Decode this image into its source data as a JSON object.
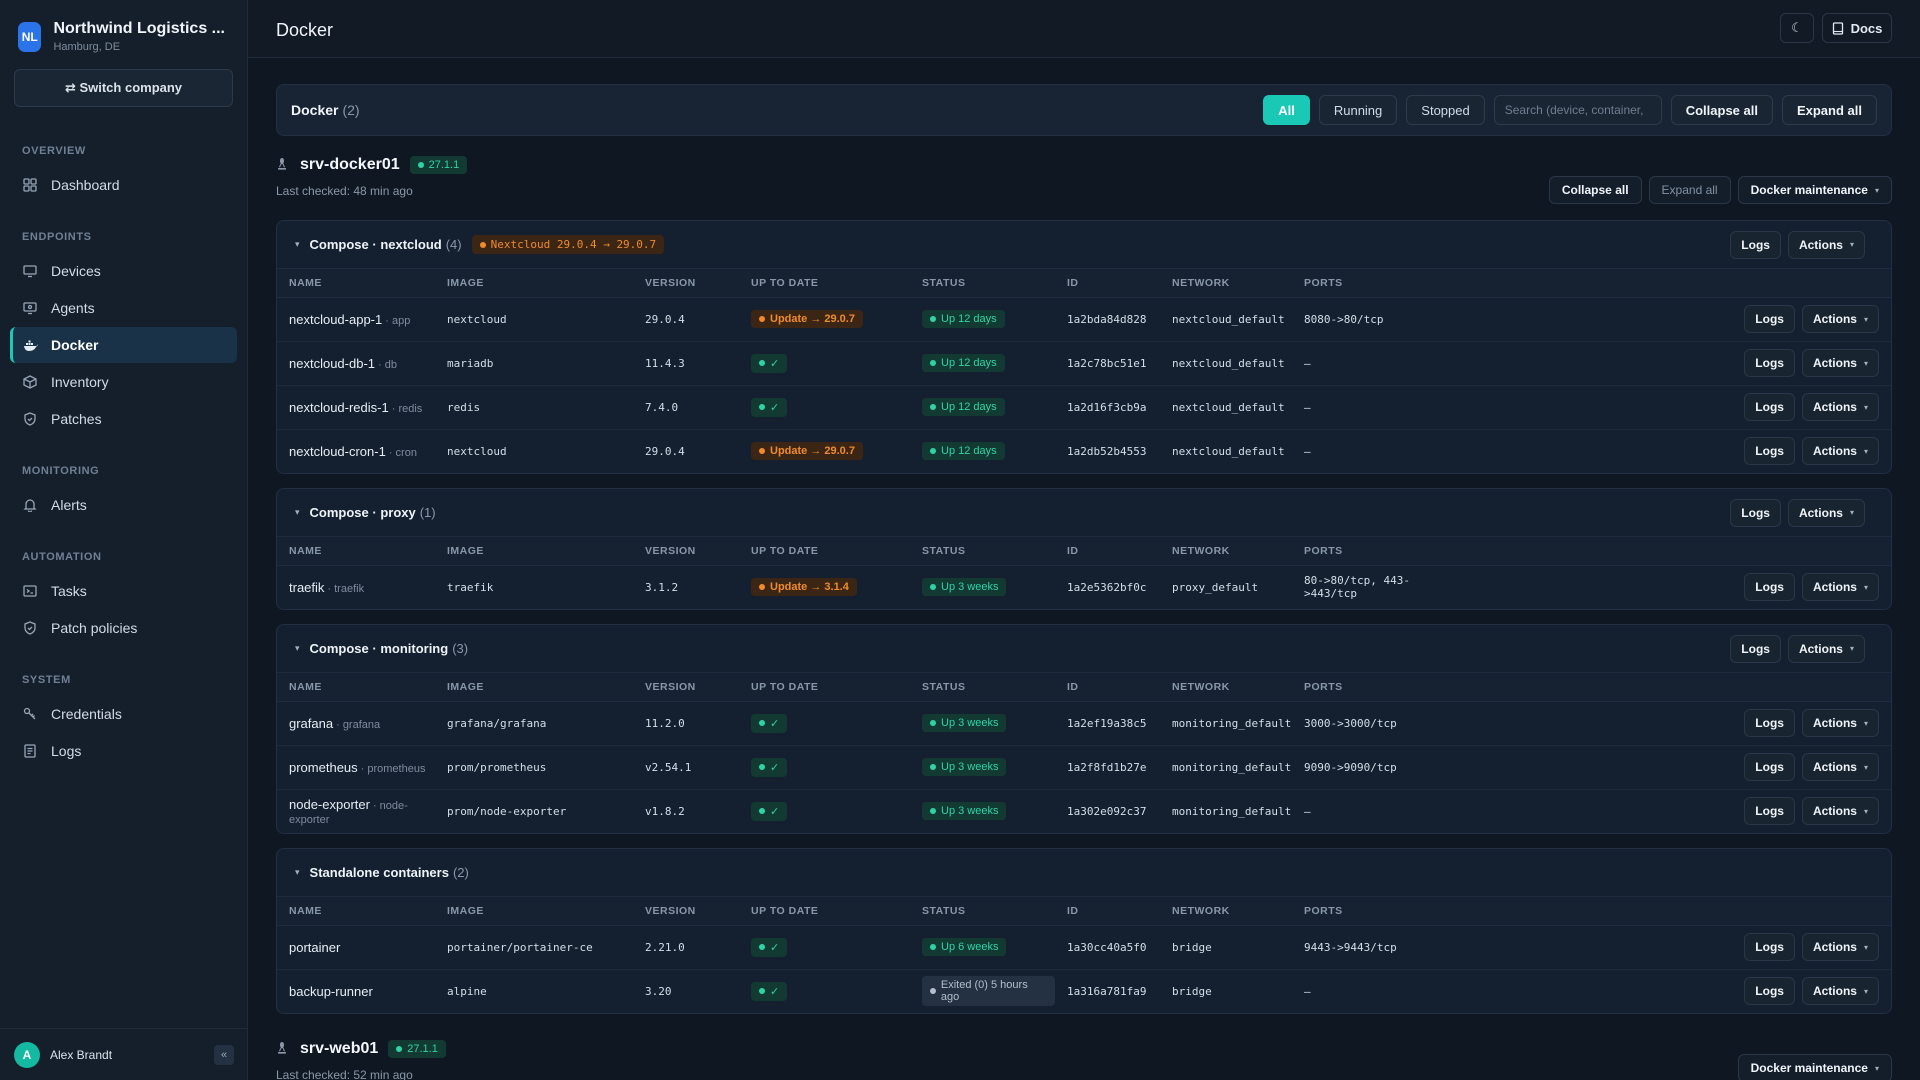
{
  "sidebar": {
    "company_initials": "NL",
    "company_name": "Northwind Logistics ...",
    "company_location": "Hamburg, DE",
    "switch_label": "⇄ Switch company",
    "sections": [
      {
        "title": "OVERVIEW",
        "items": [
          {
            "label": "Dashboard",
            "icon": "dashboard-icon"
          }
        ]
      },
      {
        "title": "ENDPOINTS",
        "items": [
          {
            "label": "Devices",
            "icon": "monitor-icon"
          },
          {
            "label": "Agents",
            "icon": "agent-icon"
          },
          {
            "label": "Docker",
            "icon": "docker-icon",
            "active": true
          },
          {
            "label": "Inventory",
            "icon": "box-icon"
          },
          {
            "label": "Patches",
            "icon": "shield-icon"
          }
        ]
      },
      {
        "title": "MONITORING",
        "items": [
          {
            "label": "Alerts",
            "icon": "bell-icon"
          }
        ]
      },
      {
        "title": "AUTOMATION",
        "items": [
          {
            "label": "Tasks",
            "icon": "terminal-icon"
          },
          {
            "label": "Patch policies",
            "icon": "shield-check-icon"
          }
        ]
      },
      {
        "title": "SYSTEM",
        "items": [
          {
            "label": "Credentials",
            "icon": "key-icon"
          },
          {
            "label": "Logs",
            "icon": "file-icon"
          }
        ]
      }
    ],
    "user_initial": "A",
    "user_name": "Alex Brandt",
    "collapse_label": "«"
  },
  "header": {
    "title": "Docker",
    "theme_icon": "moon-icon",
    "docs_label": "Docs"
  },
  "filterbar": {
    "title": "Docker",
    "count": "(2)",
    "filters": [
      "All",
      "Running",
      "Stopped"
    ],
    "search_placeholder": "Search (device, container,",
    "collapse_all": "Collapse all",
    "expand_all": "Expand all"
  },
  "columns": [
    "NAME",
    "IMAGE",
    "VERSION",
    "UP TO DATE",
    "STATUS",
    "ID",
    "NETWORK",
    "PORTS"
  ],
  "labels": {
    "logs": "Logs",
    "actions": "Actions",
    "collapse_all": "Collapse all",
    "expand_all": "Expand all",
    "docker_maintenance": "Docker maintenance"
  },
  "hosts": [
    {
      "name": "srv-docker01",
      "version": "27.1.1",
      "last_checked": "Last checked: 48 min ago",
      "groups": [
        {
          "title": "Compose · nextcloud",
          "count": "(4)",
          "badge": "Nextcloud 29.0.4 → 29.0.7",
          "rows": [
            {
              "name": "nextcloud-app-1",
              "svc": "· app",
              "image": "nextcloud",
              "version": "29.0.4",
              "uptodate": "Update → 29.0.7",
              "update": true,
              "status": "Up 12 days",
              "exited": false,
              "id": "1a2bda84d828",
              "network": "nextcloud_default",
              "ports": "8080->80/tcp"
            },
            {
              "name": "nextcloud-db-1",
              "svc": "· db",
              "image": "mariadb",
              "version": "11.4.3",
              "uptodate": "✓",
              "update": false,
              "status": "Up 12 days",
              "exited": false,
              "id": "1a2c78bc51e1",
              "network": "nextcloud_default",
              "ports": "–"
            },
            {
              "name": "nextcloud-redis-1",
              "svc": "· redis",
              "image": "redis",
              "version": "7.4.0",
              "uptodate": "✓",
              "update": false,
              "status": "Up 12 days",
              "exited": false,
              "id": "1a2d16f3cb9a",
              "network": "nextcloud_default",
              "ports": "–"
            },
            {
              "name": "nextcloud-cron-1",
              "svc": "· cron",
              "image": "nextcloud",
              "version": "29.0.4",
              "uptodate": "Update → 29.0.7",
              "update": true,
              "status": "Up 12 days",
              "exited": false,
              "id": "1a2db52b4553",
              "network": "nextcloud_default",
              "ports": "–"
            }
          ]
        },
        {
          "title": "Compose · proxy",
          "count": "(1)",
          "badge": "",
          "rows": [
            {
              "name": "traefik",
              "svc": "· traefik",
              "image": "traefik",
              "version": "3.1.2",
              "uptodate": "Update → 3.1.4",
              "update": true,
              "status": "Up 3 weeks",
              "exited": false,
              "id": "1a2e5362bf0c",
              "network": "proxy_default",
              "ports": "80->80/tcp, 443->443/tcp"
            }
          ]
        },
        {
          "title": "Compose · monitoring",
          "count": "(3)",
          "badge": "",
          "rows": [
            {
              "name": "grafana",
              "svc": "· grafana",
              "image": "grafana/grafana",
              "version": "11.2.0",
              "uptodate": "✓",
              "update": false,
              "status": "Up 3 weeks",
              "exited": false,
              "id": "1a2ef19a38c5",
              "network": "monitoring_default",
              "ports": "3000->3000/tcp"
            },
            {
              "name": "prometheus",
              "svc": "· prometheus",
              "image": "prom/prometheus",
              "version": "v2.54.1",
              "uptodate": "✓",
              "update": false,
              "status": "Up 3 weeks",
              "exited": false,
              "id": "1a2f8fd1b27e",
              "network": "monitoring_default",
              "ports": "9090->9090/tcp"
            },
            {
              "name": "node-exporter",
              "svc": "· node-exporter",
              "image": "prom/node-exporter",
              "version": "v1.8.2",
              "uptodate": "✓",
              "update": false,
              "status": "Up 3 weeks",
              "exited": false,
              "id": "1a302e092c37",
              "network": "monitoring_default",
              "ports": "–"
            }
          ]
        },
        {
          "title": "Standalone containers",
          "count": "(2)",
          "badge": "",
          "rows": [
            {
              "name": "portainer",
              "svc": "",
              "image": "portainer/portainer-ce",
              "version": "2.21.0",
              "uptodate": "✓",
              "update": false,
              "status": "Up 6 weeks",
              "exited": false,
              "id": "1a30cc40a5f0",
              "network": "bridge",
              "ports": "9443->9443/tcp"
            },
            {
              "name": "backup-runner",
              "svc": "",
              "image": "alpine",
              "version": "3.20",
              "uptodate": "✓",
              "update": false,
              "status": "Exited (0) 5 hours ago",
              "exited": true,
              "id": "1a316a781fa9",
              "network": "bridge",
              "ports": "–"
            }
          ]
        }
      ]
    },
    {
      "name": "srv-web01",
      "version": "27.1.1",
      "last_checked": "Last checked: 52 min ago",
      "groups": []
    }
  ],
  "colors": {
    "accent": "#1ac8b6",
    "ok": "#2ed4a6",
    "warn": "#f08a2a",
    "bg": "#0f1722"
  }
}
